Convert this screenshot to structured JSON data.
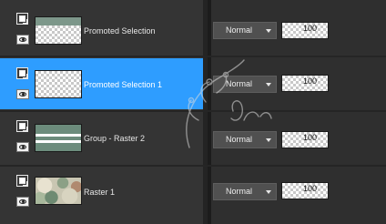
{
  "layers": [
    {
      "name": "Promoted Selection",
      "blend_mode": "Normal",
      "opacity": "100",
      "selected": false,
      "thumb": "green-band"
    },
    {
      "name": "Promoted Selection 1",
      "blend_mode": "Normal",
      "opacity": "100",
      "selected": true,
      "thumb": "transparent"
    },
    {
      "name": "Group - Raster 2",
      "blend_mode": "Normal",
      "opacity": "100",
      "selected": false,
      "thumb": "green-stripes"
    },
    {
      "name": "Raster 1",
      "blend_mode": "Normal",
      "opacity": "100",
      "selected": false,
      "thumb": "camo"
    }
  ],
  "icons": {
    "visibility": "eye-icon",
    "link": "chain-icon",
    "dropdown": "chevron-down-icon"
  },
  "colors": {
    "panel_bg": "#343434",
    "selection": "#2e9dff",
    "control_bg": "#505050"
  },
  "watermark": {
    "text": "Tutorial"
  }
}
